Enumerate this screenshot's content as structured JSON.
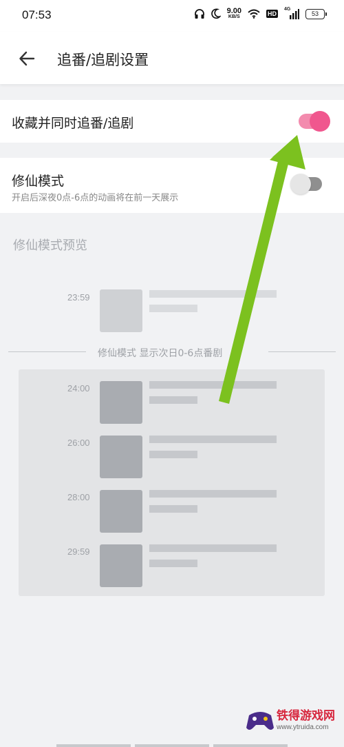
{
  "status_bar": {
    "time": "07:53",
    "net_speed_value": "9.00",
    "net_speed_unit": "KB/S",
    "hd_label": "HD",
    "signal_label": "4G",
    "battery": "53",
    "icons": [
      "headphones-icon",
      "moon-icon",
      "wifi-icon",
      "signal-icon",
      "battery-icon"
    ]
  },
  "header": {
    "title": "追番/追剧设置",
    "back_icon": "back-arrow-icon"
  },
  "settings": {
    "favorite_follow": {
      "label": "收藏并同时追番/追剧",
      "enabled": true
    },
    "immortal_mode": {
      "label": "修仙模式",
      "description": "开启后深夜0点-6点的动画将在前一天展示",
      "enabled": false
    }
  },
  "preview": {
    "title": "修仙模式预览",
    "before_item": {
      "time": "23:59"
    },
    "divider_text": "修仙模式 显示次日0-6点番剧",
    "night_items": [
      {
        "time": "24:00"
      },
      {
        "time": "26:00"
      },
      {
        "time": "28:00"
      },
      {
        "time": "29:59"
      }
    ]
  },
  "colors": {
    "accent_pink": "#f0578e",
    "annotation_arrow": "#7cc11f"
  },
  "watermark": {
    "name": "铁得游戏网",
    "url": "www.ytruida.com"
  }
}
